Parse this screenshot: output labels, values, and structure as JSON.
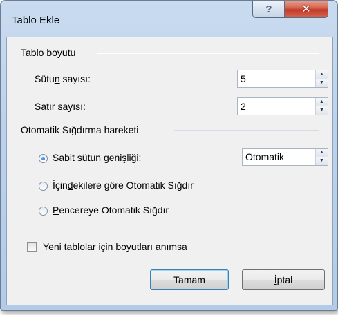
{
  "window": {
    "title": "Tablo Ekle",
    "help_glyph": "?",
    "close_glyph": "✕"
  },
  "table_size": {
    "group_label": "Tablo boyutu",
    "columns": {
      "label_pre": "Sütu",
      "label_underlined": "n",
      "label_post": " sayısı:",
      "value": "5"
    },
    "rows": {
      "label_pre": "Sat",
      "label_underlined": "ı",
      "label_post": "r sayısı:",
      "value": "2"
    }
  },
  "autofit": {
    "group_label": "Otomatik Sığdırma hareketi",
    "options": [
      {
        "pre": "Sa",
        "underlined": "b",
        "post": "it sütun genişliği:",
        "selected": true
      },
      {
        "pre": "İçin",
        "underlined": "d",
        "post": "ekilere göre Otomatik Sığdır",
        "selected": false
      },
      {
        "pre": "",
        "underlined": "P",
        "post": "encereye Otomatik Sığdır",
        "selected": false
      }
    ],
    "fixed_width_value": "Otomatik"
  },
  "remember": {
    "underlined": "Y",
    "post": "eni tablolar için boyutları anımsa",
    "checked": false
  },
  "buttons": {
    "ok": "Tamam",
    "cancel_underlined": "İ",
    "cancel_post": "ptal"
  },
  "icons": {
    "spin_up": "▲",
    "spin_down": "▼"
  }
}
